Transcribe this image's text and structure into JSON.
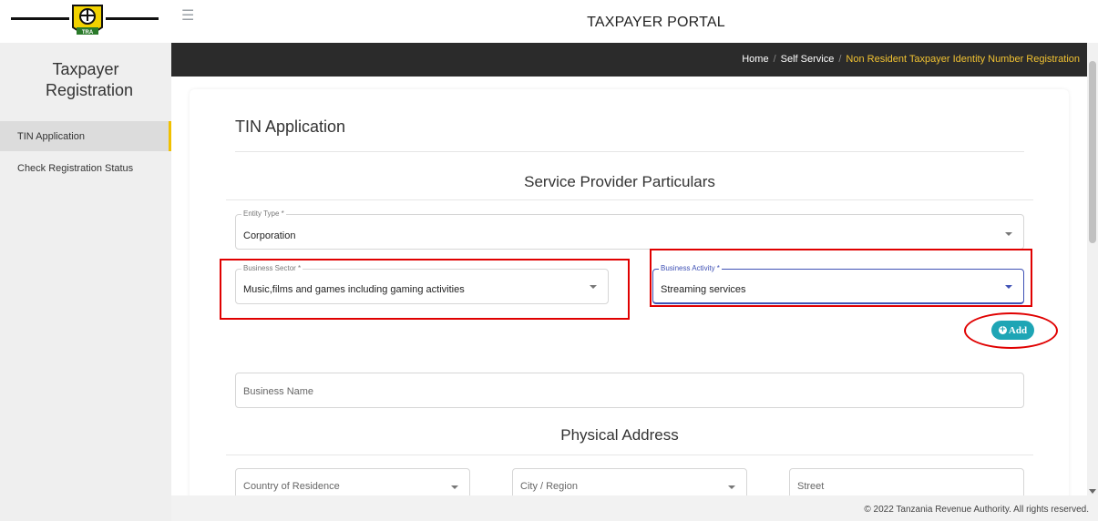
{
  "header": {
    "portal_title": "TAXPAYER PORTAL",
    "logo_text": "TRA",
    "menu_icon": "hamburger-icon"
  },
  "sidebar": {
    "title": "Taxpayer Registration",
    "items": [
      {
        "label": "TIN Application",
        "active": true
      },
      {
        "label": "Check Registration Status",
        "active": false
      }
    ]
  },
  "breadcrumb": {
    "items": [
      "Home",
      "Self Service"
    ],
    "current": "Non Resident Taxpayer Identity Number Registration",
    "separator": "/"
  },
  "form": {
    "title": "TIN Application",
    "service_section_title": "Service Provider Particulars",
    "entity_type": {
      "label": "Entity Type *",
      "value": "Corporation"
    },
    "business_sector": {
      "label": "Business Sector *",
      "value": "Music,films and games including gaming activities"
    },
    "business_activity": {
      "label": "Business Activity *",
      "value": "Streaming services"
    },
    "add_button": "Add",
    "business_name": {
      "placeholder": "Business Name"
    },
    "physical_section_title": "Physical Address",
    "country": {
      "placeholder": "Country of Residence"
    },
    "city": {
      "placeholder": "City / Region"
    },
    "street": {
      "placeholder": "Street"
    }
  },
  "footer": {
    "text": "© 2022 Tanzania Revenue Authority. All rights reserved."
  },
  "colors": {
    "breadcrumb_bg": "#2b2b2b",
    "breadcrumb_current": "#f1c232",
    "active_indicator": "#f0c000",
    "add_button": "#1ea5b5",
    "focus": "#3f51b5",
    "annotation": "#e00000"
  }
}
